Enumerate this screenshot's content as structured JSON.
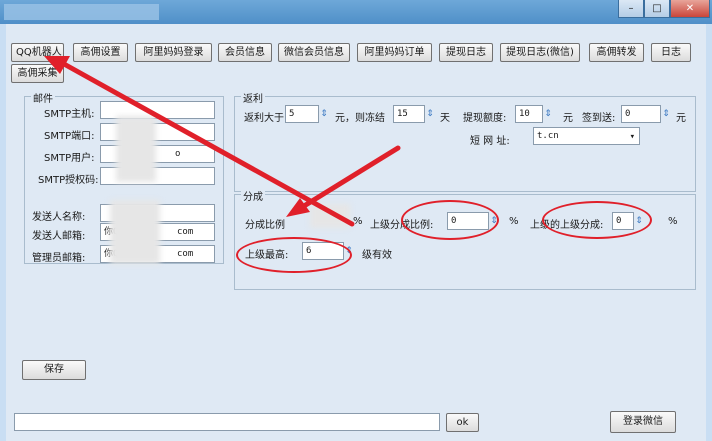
{
  "window": {
    "minimize_label": "–",
    "maximize_label": "□",
    "close_label": "✕"
  },
  "toolbar": {
    "buttons": [
      "QQ机器人",
      "高佣设置",
      "阿里妈妈登录",
      "会员信息",
      "微信会员信息",
      "阿里妈妈订单",
      "提现日志",
      "提现日志(微信)",
      "高佣转发",
      "日志"
    ],
    "second_row": [
      "高佣采集"
    ]
  },
  "mail": {
    "title": "邮件",
    "smtp_host_label": "SMTP主机:",
    "smtp_port_label": "SMTP端口:",
    "smtp_user_label": "SMTP用户:",
    "smtp_code_label": "SMTP授权码:",
    "smtp_user_value_tail": "o",
    "smtp_code_value_head": "*",
    "sender_name_label": "发送人名称:",
    "sender_mail_label": "发送人邮箱:",
    "admin_mail_label": "管理员邮箱:",
    "sender_mail_value_head": "你QQ号",
    "sender_mail_value_tail": "com",
    "admin_mail_value_head": "你QQ号",
    "admin_mail_value_tail": "com"
  },
  "rebate": {
    "title": "返利",
    "over_label": "返利大于",
    "over_value": "5",
    "unit_yuan_freeze": "元，则冻结",
    "freeze_value": "15",
    "unit_day": "天",
    "withdraw_label": "提现额度:",
    "withdraw_value": "10",
    "unit_yuan": "元",
    "checkin_label": "签到送:",
    "checkin_value": "0",
    "unit_yuan2": "元",
    "short_url_label": "短 网 址:",
    "short_url_value": "t.cn"
  },
  "share": {
    "title": "分成",
    "ratio_label": "分成比例",
    "percent1": "%",
    "upper_ratio_label": "上级分成比例:",
    "upper_ratio_value": "0",
    "percent2": "%",
    "upper_upper_label": "上级的上级分成:",
    "upper_upper_value": "0",
    "percent3": "%",
    "max_level_label": "上级最高:",
    "max_level_value": "6",
    "level_suffix": "级有效"
  },
  "footer": {
    "save_label": "保存",
    "ok_label": "ok",
    "login_wechat_label": "登录微信",
    "command_value": ""
  },
  "spin_glyph": "⇕",
  "colors": {
    "annotation": "#e0202a"
  }
}
